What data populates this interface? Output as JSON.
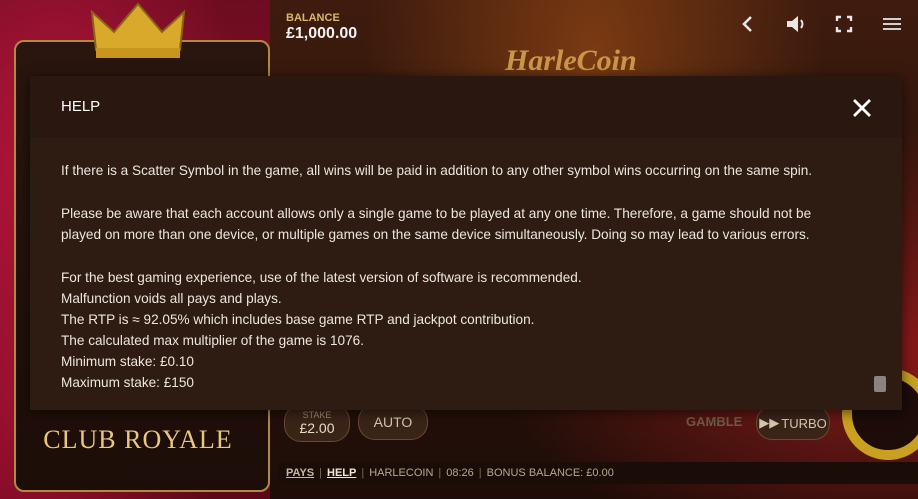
{
  "header": {
    "balance_label": "BALANCE",
    "balance_value": "£1,000.00"
  },
  "icons": {
    "back": "chevron-left-icon",
    "sound": "speaker-icon",
    "fullscreen": "fullscreen-icon",
    "menu": "hamburger-menu-icon",
    "close": "close-icon"
  },
  "sidebar": {
    "club_name": "CLUB ROYALE"
  },
  "game": {
    "logo": "HarleCoin"
  },
  "controls": {
    "stake_label": "STAKE",
    "stake_value": "£2.00",
    "auto_label": "AUTO",
    "gamble_label": "GAMBLE",
    "turbo_label": "TURBO"
  },
  "footer": {
    "pays": "PAYS",
    "help": "HELP",
    "game_name": "HARLECOIN",
    "time": "08:26",
    "bonus_balance": "BONUS BALANCE: £0.00"
  },
  "modal": {
    "title": "HELP",
    "paragraph_1": "If there is a Scatter Symbol in the game, all wins will be paid in addition to any other symbol wins occurring on the same spin.",
    "paragraph_2_line_1": "Please be aware that each account allows only a single game to be played at any one time. Therefore, a game should not be",
    "paragraph_2_line_2": "played on more than one device, or multiple games on the same device simultaneously. Doing so may lead to various errors.",
    "line_software": "For the best gaming experience, use of the latest version of software is recommended.",
    "line_malfunction": "Malfunction voids all pays and plays.",
    "line_rtp": "The RTP is ≈ 92.05% which includes base game RTP and jackpot contribution.",
    "line_max_multiplier": "The calculated max multiplier of the game is 1076.",
    "line_min_stake": "Minimum stake: £0.10",
    "line_max_stake": "Maximum stake: £150"
  },
  "colors": {
    "modal_bg": "#2e1c12",
    "accent_gold": "#c9a020",
    "brand_red": "#8a1027"
  }
}
